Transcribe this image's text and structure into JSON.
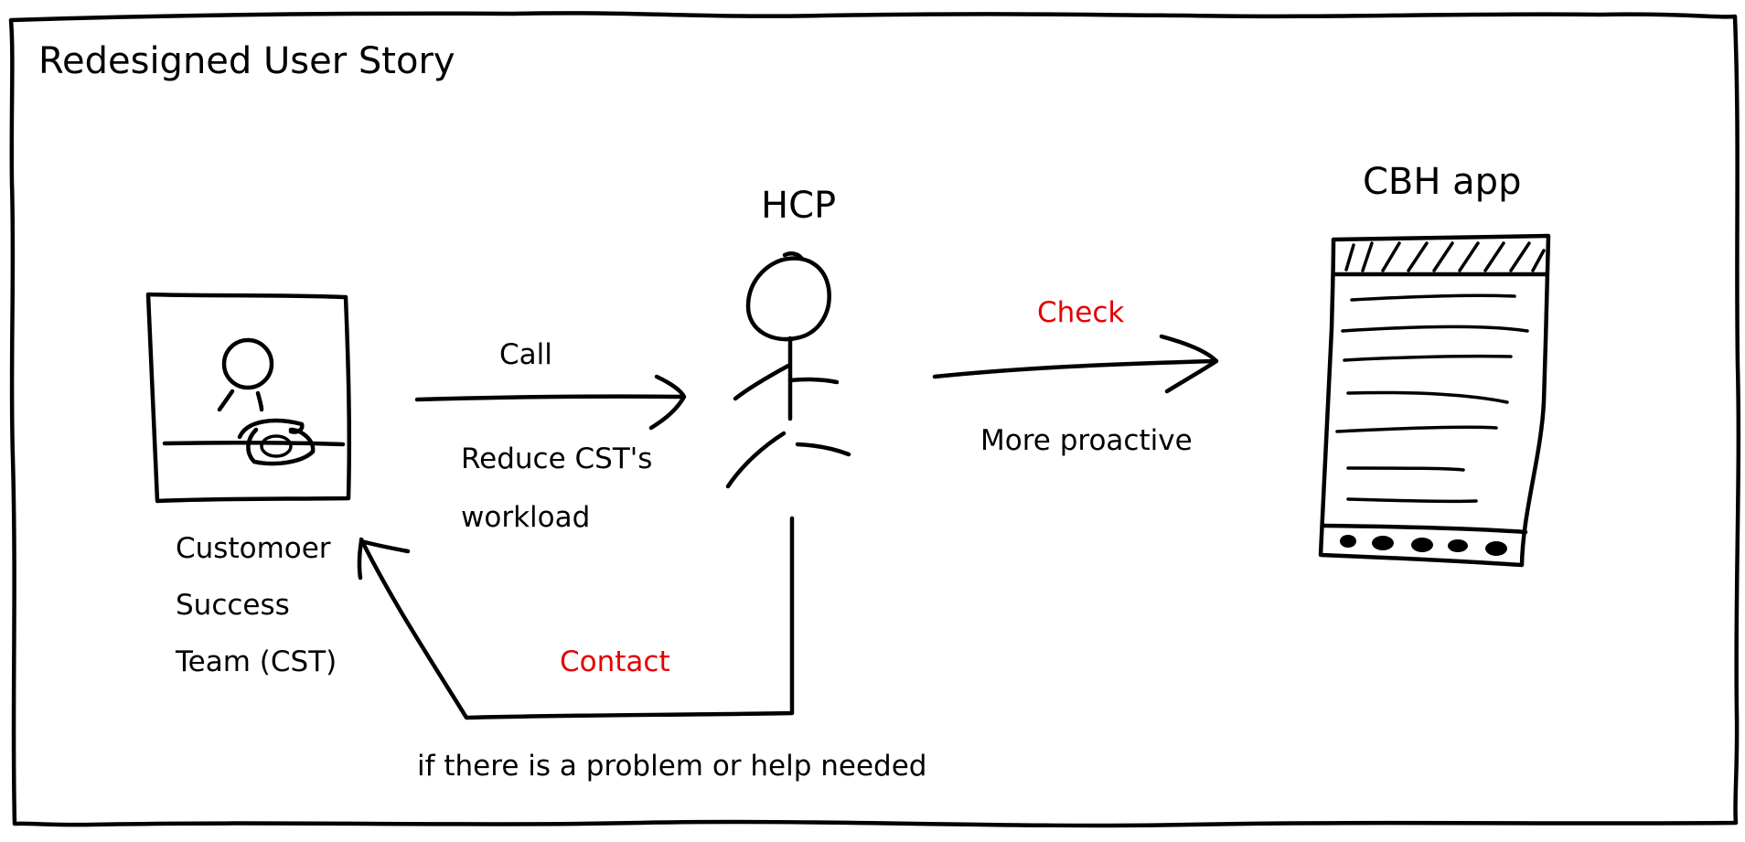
{
  "diagram": {
    "title": "Redesigned User Story",
    "actors": {
      "cst": {
        "label_lines": [
          "Customoer",
          "Success",
          "Team (CST)"
        ]
      },
      "hcp": {
        "label": "HCP"
      },
      "app": {
        "label": "CBH app"
      }
    },
    "edges": {
      "call": {
        "label": "Call",
        "note_lines": [
          "Reduce CST's",
          "workload"
        ]
      },
      "check": {
        "label": "Check",
        "note": "More proactive",
        "label_color": "#e60000"
      },
      "contact": {
        "label": "Contact",
        "note": "if there is a problem or help needed",
        "label_color": "#e60000"
      }
    }
  }
}
